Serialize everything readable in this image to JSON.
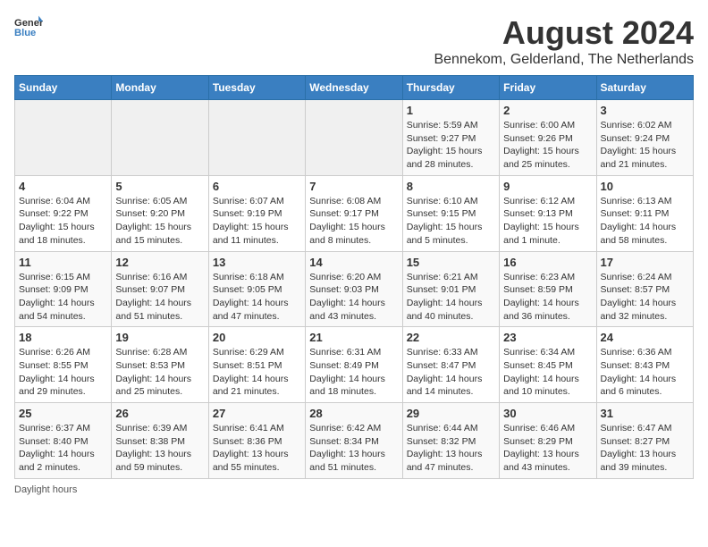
{
  "header": {
    "logo_general": "General",
    "logo_blue": "Blue",
    "main_title": "August 2024",
    "subtitle": "Bennekom, Gelderland, The Netherlands"
  },
  "days_of_week": [
    "Sunday",
    "Monday",
    "Tuesday",
    "Wednesday",
    "Thursday",
    "Friday",
    "Saturday"
  ],
  "weeks": [
    [
      {
        "day": "",
        "info": ""
      },
      {
        "day": "",
        "info": ""
      },
      {
        "day": "",
        "info": ""
      },
      {
        "day": "",
        "info": ""
      },
      {
        "day": "1",
        "info": "Sunrise: 5:59 AM\nSunset: 9:27 PM\nDaylight: 15 hours and 28 minutes."
      },
      {
        "day": "2",
        "info": "Sunrise: 6:00 AM\nSunset: 9:26 PM\nDaylight: 15 hours and 25 minutes."
      },
      {
        "day": "3",
        "info": "Sunrise: 6:02 AM\nSunset: 9:24 PM\nDaylight: 15 hours and 21 minutes."
      }
    ],
    [
      {
        "day": "4",
        "info": "Sunrise: 6:04 AM\nSunset: 9:22 PM\nDaylight: 15 hours and 18 minutes."
      },
      {
        "day": "5",
        "info": "Sunrise: 6:05 AM\nSunset: 9:20 PM\nDaylight: 15 hours and 15 minutes."
      },
      {
        "day": "6",
        "info": "Sunrise: 6:07 AM\nSunset: 9:19 PM\nDaylight: 15 hours and 11 minutes."
      },
      {
        "day": "7",
        "info": "Sunrise: 6:08 AM\nSunset: 9:17 PM\nDaylight: 15 hours and 8 minutes."
      },
      {
        "day": "8",
        "info": "Sunrise: 6:10 AM\nSunset: 9:15 PM\nDaylight: 15 hours and 5 minutes."
      },
      {
        "day": "9",
        "info": "Sunrise: 6:12 AM\nSunset: 9:13 PM\nDaylight: 15 hours and 1 minute."
      },
      {
        "day": "10",
        "info": "Sunrise: 6:13 AM\nSunset: 9:11 PM\nDaylight: 14 hours and 58 minutes."
      }
    ],
    [
      {
        "day": "11",
        "info": "Sunrise: 6:15 AM\nSunset: 9:09 PM\nDaylight: 14 hours and 54 minutes."
      },
      {
        "day": "12",
        "info": "Sunrise: 6:16 AM\nSunset: 9:07 PM\nDaylight: 14 hours and 51 minutes."
      },
      {
        "day": "13",
        "info": "Sunrise: 6:18 AM\nSunset: 9:05 PM\nDaylight: 14 hours and 47 minutes."
      },
      {
        "day": "14",
        "info": "Sunrise: 6:20 AM\nSunset: 9:03 PM\nDaylight: 14 hours and 43 minutes."
      },
      {
        "day": "15",
        "info": "Sunrise: 6:21 AM\nSunset: 9:01 PM\nDaylight: 14 hours and 40 minutes."
      },
      {
        "day": "16",
        "info": "Sunrise: 6:23 AM\nSunset: 8:59 PM\nDaylight: 14 hours and 36 minutes."
      },
      {
        "day": "17",
        "info": "Sunrise: 6:24 AM\nSunset: 8:57 PM\nDaylight: 14 hours and 32 minutes."
      }
    ],
    [
      {
        "day": "18",
        "info": "Sunrise: 6:26 AM\nSunset: 8:55 PM\nDaylight: 14 hours and 29 minutes."
      },
      {
        "day": "19",
        "info": "Sunrise: 6:28 AM\nSunset: 8:53 PM\nDaylight: 14 hours and 25 minutes."
      },
      {
        "day": "20",
        "info": "Sunrise: 6:29 AM\nSunset: 8:51 PM\nDaylight: 14 hours and 21 minutes."
      },
      {
        "day": "21",
        "info": "Sunrise: 6:31 AM\nSunset: 8:49 PM\nDaylight: 14 hours and 18 minutes."
      },
      {
        "day": "22",
        "info": "Sunrise: 6:33 AM\nSunset: 8:47 PM\nDaylight: 14 hours and 14 minutes."
      },
      {
        "day": "23",
        "info": "Sunrise: 6:34 AM\nSunset: 8:45 PM\nDaylight: 14 hours and 10 minutes."
      },
      {
        "day": "24",
        "info": "Sunrise: 6:36 AM\nSunset: 8:43 PM\nDaylight: 14 hours and 6 minutes."
      }
    ],
    [
      {
        "day": "25",
        "info": "Sunrise: 6:37 AM\nSunset: 8:40 PM\nDaylight: 14 hours and 2 minutes."
      },
      {
        "day": "26",
        "info": "Sunrise: 6:39 AM\nSunset: 8:38 PM\nDaylight: 13 hours and 59 minutes."
      },
      {
        "day": "27",
        "info": "Sunrise: 6:41 AM\nSunset: 8:36 PM\nDaylight: 13 hours and 55 minutes."
      },
      {
        "day": "28",
        "info": "Sunrise: 6:42 AM\nSunset: 8:34 PM\nDaylight: 13 hours and 51 minutes."
      },
      {
        "day": "29",
        "info": "Sunrise: 6:44 AM\nSunset: 8:32 PM\nDaylight: 13 hours and 47 minutes."
      },
      {
        "day": "30",
        "info": "Sunrise: 6:46 AM\nSunset: 8:29 PM\nDaylight: 13 hours and 43 minutes."
      },
      {
        "day": "31",
        "info": "Sunrise: 6:47 AM\nSunset: 8:27 PM\nDaylight: 13 hours and 39 minutes."
      }
    ]
  ],
  "footer": {
    "note": "Daylight hours"
  }
}
